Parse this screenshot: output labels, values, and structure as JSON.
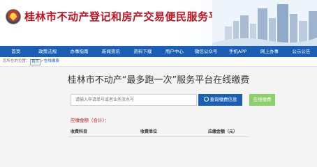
{
  "header": {
    "title": "桂林市不动产登记和房产交易便民服务平台"
  },
  "nav": {
    "items": [
      "首页",
      "政策法规",
      "办事指南",
      "新闻资讯",
      "资料下载",
      "用户中心",
      "微信公众号",
      "手机APP",
      "网上办事",
      "公示公告"
    ]
  },
  "breadcrumb": {
    "prefix": "您所在的位置：",
    "home": "首页",
    "separator": ">",
    "current": "在线缴费"
  },
  "main": {
    "title": "桂林市不动产“最多跑一次”服务平台在线缴费",
    "search_placeholder": "请输入申请单号或者业务流水号",
    "search_button": "查询缴费信息",
    "pay_button": "在线缴费",
    "amount_label": "应缴金额（合计）",
    "amount_colon": "：",
    "table_headers": [
      "收费科目",
      "收费单位",
      "应缴金额（元）"
    ]
  },
  "colors": {
    "brand_red": "#c1121f",
    "nav_blue": "#1a5fb4",
    "pay_green": "#8dcf6a"
  }
}
